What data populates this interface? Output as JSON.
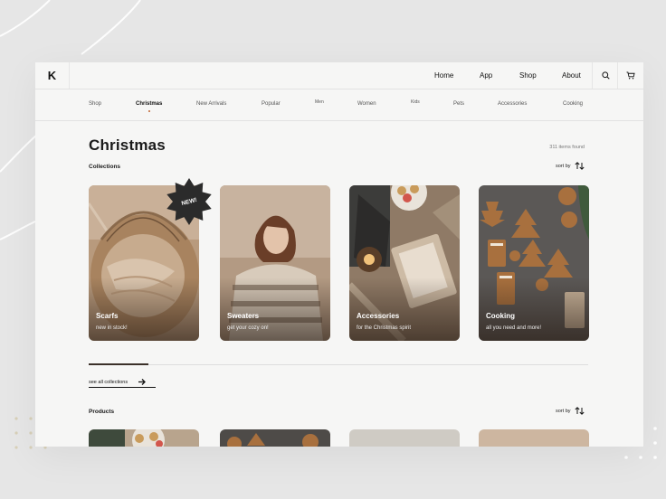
{
  "brand": {
    "logo": "K"
  },
  "main_nav": [
    {
      "label": "Home"
    },
    {
      "label": "App"
    },
    {
      "label": "Shop"
    },
    {
      "label": "About"
    }
  ],
  "categories": [
    {
      "label": "Shop"
    },
    {
      "label": "Christmas",
      "active": true
    },
    {
      "label": "New Arrivals"
    },
    {
      "label": "Popular"
    },
    {
      "label": "Men"
    },
    {
      "label": "Women"
    },
    {
      "label": "Kids"
    },
    {
      "label": "Pets"
    },
    {
      "label": "Accessories"
    },
    {
      "label": "Cooking"
    }
  ],
  "page": {
    "title": "Christmas",
    "items_found": "311 items found"
  },
  "collections": {
    "label": "Collections",
    "sort_label": "sort by",
    "badge": "NEW!",
    "cards": [
      {
        "title": "Scarfs",
        "subtitle": "new in stock!"
      },
      {
        "title": "Sweaters",
        "subtitle": "get your cozy on!"
      },
      {
        "title": "Accessories",
        "subtitle": "for the Christmas spirit"
      },
      {
        "title": "Cooking",
        "subtitle": "all you need and more!"
      }
    ],
    "see_all": "see all collections",
    "carousel_progress": 0.12
  },
  "products": {
    "label": "Products",
    "sort_label": "sort by"
  },
  "colors": {
    "accent": "#c0632f",
    "badge": "#2b2b2b",
    "text": "#1a1a1a",
    "background": "#f6f6f5"
  },
  "icons": [
    "search-icon",
    "cart-icon",
    "sort-icon",
    "arrow-right-icon",
    "new-badge-star"
  ]
}
